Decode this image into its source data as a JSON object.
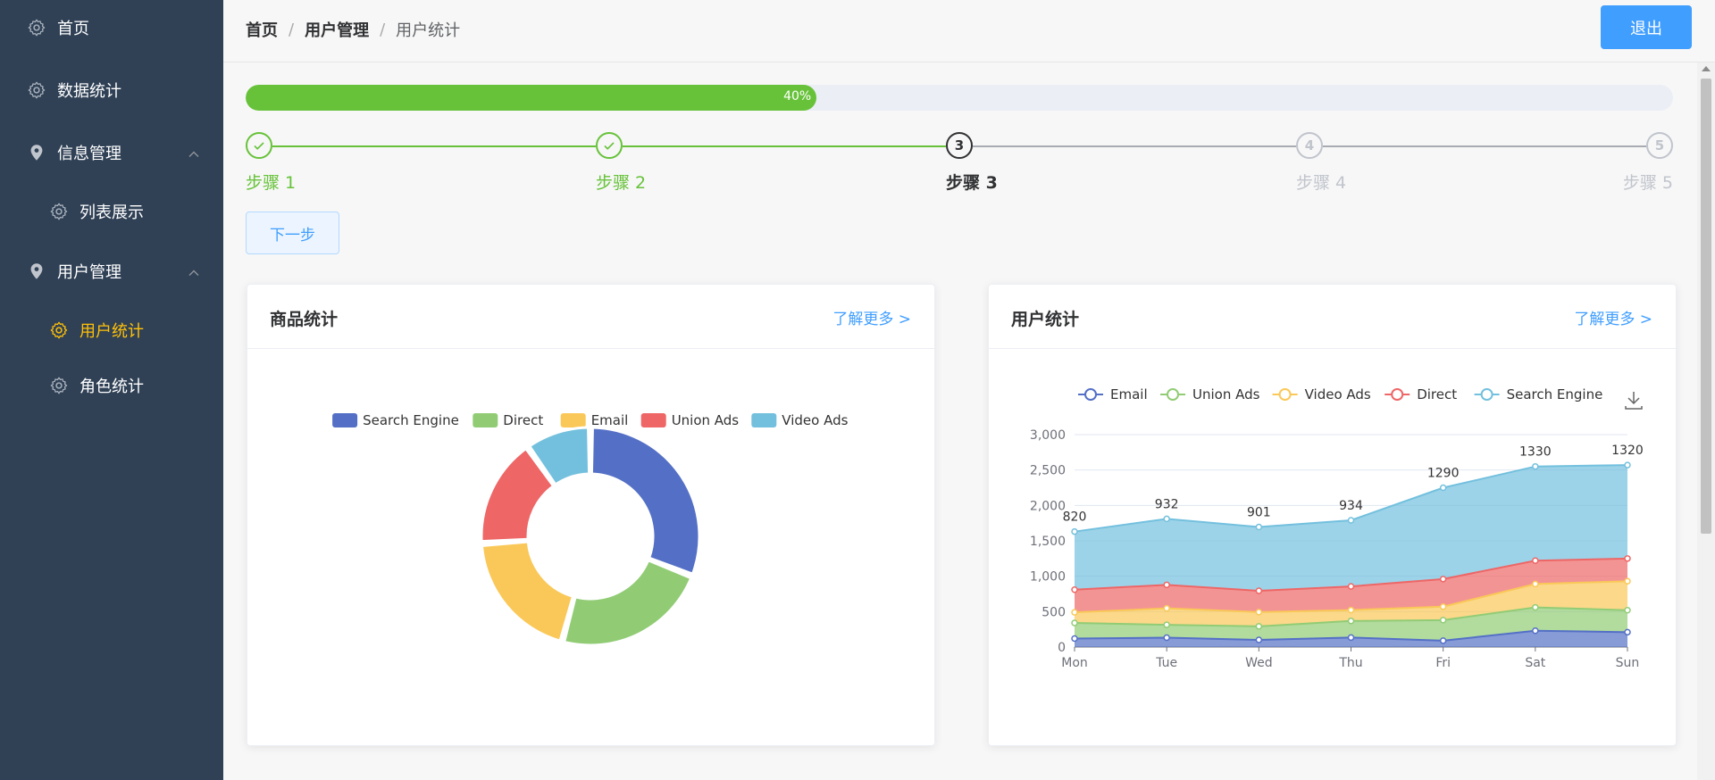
{
  "sidebar": {
    "items": [
      {
        "label": "首页",
        "icon": "gear-icon",
        "level": 1,
        "top": 2,
        "active": false
      },
      {
        "label": "数据统计",
        "icon": "gear-icon",
        "level": 1,
        "top": 72,
        "active": false
      },
      {
        "label": "信息管理",
        "icon": "location-pin-icon",
        "level": 1,
        "top": 142,
        "active": false,
        "expanded": true
      },
      {
        "label": "列表展示",
        "icon": "gear-icon",
        "level": 2,
        "top": 208,
        "active": false
      },
      {
        "label": "用户管理",
        "icon": "location-pin-icon",
        "level": 1,
        "top": 275,
        "active": false,
        "expanded": true
      },
      {
        "label": "用户统计",
        "icon": "gear-icon",
        "level": 2,
        "top": 341,
        "active": true
      },
      {
        "label": "角色统计",
        "icon": "gear-icon",
        "level": 2,
        "top": 403,
        "active": false
      }
    ]
  },
  "header": {
    "breadcrumb": [
      "首页",
      "用户管理",
      "用户统计"
    ],
    "separator": "/",
    "logout_label": "退出"
  },
  "progress": {
    "percent": 40,
    "label": "40%"
  },
  "steps": {
    "active": 3,
    "items": [
      {
        "number": "1",
        "title": "步骤 1"
      },
      {
        "number": "2",
        "title": "步骤 2"
      },
      {
        "number": "3",
        "title": "步骤 3"
      },
      {
        "number": "4",
        "title": "步骤 4"
      },
      {
        "number": "5",
        "title": "步骤 5"
      }
    ],
    "next_label": "下一步"
  },
  "colors": {
    "success": "#67c23a",
    "primary": "#409eff",
    "sidebar_bg": "#304156",
    "active_menu": "#ffc107",
    "wait": "#c0c4cc"
  },
  "cards": {
    "goods": {
      "title": "商品统计",
      "link": "了解更多 >"
    },
    "users": {
      "title": "用户统计",
      "link": "了解更多 >"
    }
  },
  "chart_data": [
    {
      "type": "pie",
      "title": "",
      "donut": true,
      "legend_position": "top",
      "series": [
        {
          "name": "Search Engine",
          "value": 1330,
          "color": "#5470c6"
        },
        {
          "name": "Direct",
          "value": 1000,
          "color": "#91cc75"
        },
        {
          "name": "Email",
          "value": 850,
          "color": "#fac858"
        },
        {
          "name": "Union Ads",
          "value": 700,
          "color": "#ee6666"
        },
        {
          "name": "Video Ads",
          "value": 420,
          "color": "#73c0de"
        }
      ]
    },
    {
      "type": "area",
      "stacked": true,
      "title": "",
      "legend_position": "top",
      "toolbox": "download-icon",
      "categories": [
        "Mon",
        "Tue",
        "Wed",
        "Thu",
        "Fri",
        "Sat",
        "Sun"
      ],
      "ylim": [
        0,
        3000
      ],
      "yticks": [
        0,
        500,
        1000,
        1500,
        2000,
        2500,
        3000
      ],
      "ytick_labels": [
        "0",
        "500",
        "1,000",
        "1,500",
        "2,000",
        "2,500",
        "3,000"
      ],
      "grid": true,
      "series": [
        {
          "name": "Email",
          "color": "#5470c6",
          "values": [
            120,
            132,
            101,
            134,
            90,
            230,
            210
          ]
        },
        {
          "name": "Union Ads",
          "color": "#91cc75",
          "values": [
            220,
            182,
            191,
            234,
            290,
            330,
            310
          ]
        },
        {
          "name": "Video Ads",
          "color": "#fac858",
          "values": [
            150,
            232,
            201,
            154,
            190,
            330,
            410
          ]
        },
        {
          "name": "Direct",
          "color": "#ee6666",
          "values": [
            320,
            332,
            301,
            334,
            390,
            330,
            320
          ]
        },
        {
          "name": "Search Engine",
          "color": "#73c0de",
          "values": [
            820,
            932,
            901,
            934,
            1290,
            1330,
            1320
          ]
        }
      ],
      "top_labels": [
        "820",
        "932",
        "901",
        "934",
        "1290",
        "1330",
        "1320"
      ]
    }
  ]
}
